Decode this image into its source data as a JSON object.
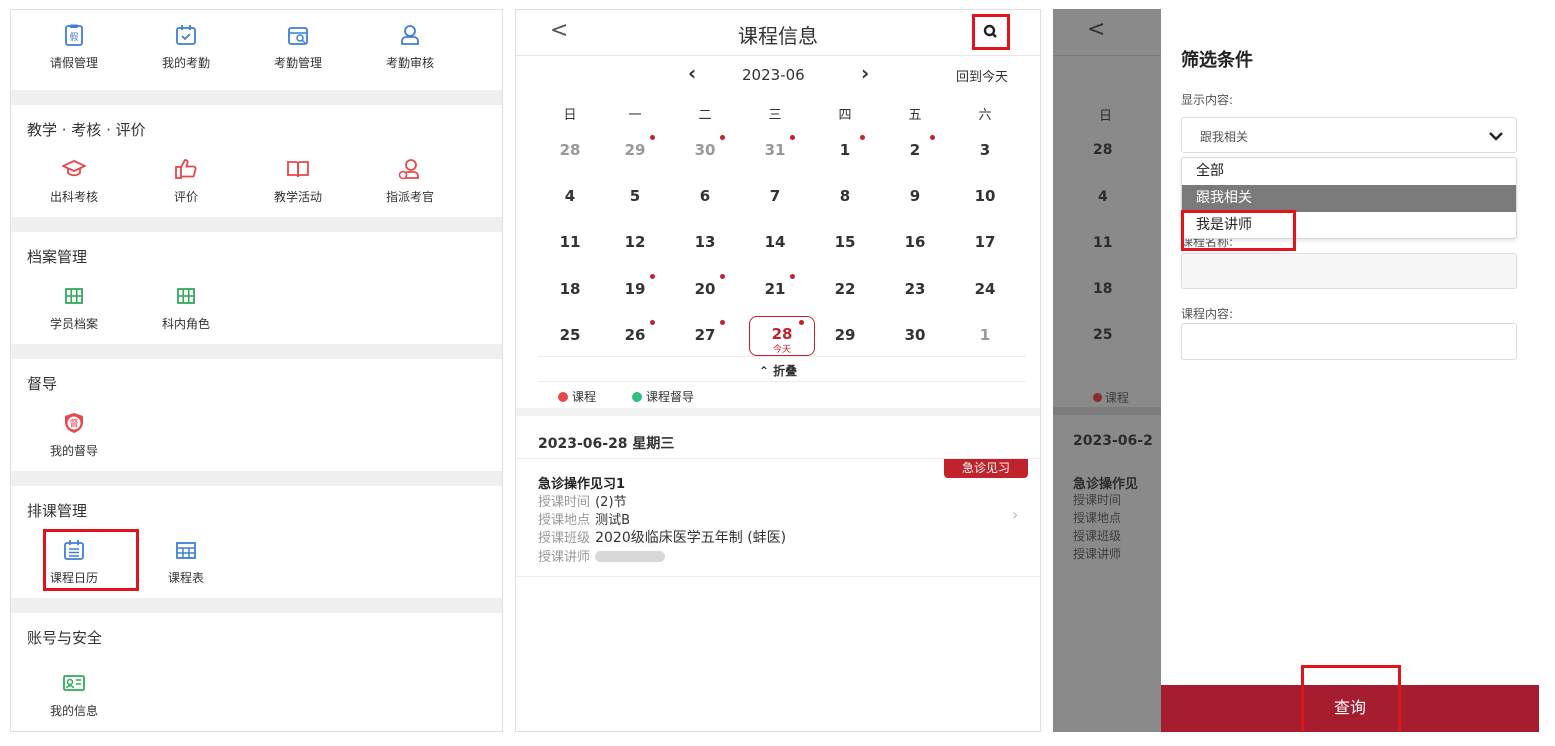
{
  "panel1": {
    "sections": [
      {
        "title": "",
        "items": [
          {
            "label": "请假管理",
            "icon": "leave-clipboard-icon"
          },
          {
            "label": "我的考勤",
            "icon": "calendar-check-icon"
          },
          {
            "label": "考勤管理",
            "icon": "calendar-search-icon"
          },
          {
            "label": "考勤审核",
            "icon": "user-review-icon"
          }
        ]
      },
      {
        "title": "教学 · 考核 · 评价",
        "items": [
          {
            "label": "出科考核",
            "icon": "graduation-cap-icon"
          },
          {
            "label": "评价",
            "icon": "thumbs-up-icon"
          },
          {
            "label": "教学活动",
            "icon": "open-book-icon"
          },
          {
            "label": "指派考官",
            "icon": "assign-user-icon"
          }
        ]
      },
      {
        "title": "档案管理",
        "items": [
          {
            "label": "学员档案",
            "icon": "grid-icon"
          },
          {
            "label": "科内角色",
            "icon": "grid-icon"
          }
        ]
      },
      {
        "title": "督导",
        "items": [
          {
            "label": "我的督导",
            "icon": "supervise-shield-icon",
            "glyph": "督"
          }
        ]
      },
      {
        "title": "排课管理",
        "items": [
          {
            "label": "课程日历",
            "icon": "course-calendar-icon"
          },
          {
            "label": "课程表",
            "icon": "timetable-icon"
          }
        ]
      },
      {
        "title": "账号与安全",
        "items": [
          {
            "label": "我的信息",
            "icon": "id-card-icon"
          }
        ]
      }
    ]
  },
  "panel2": {
    "back_icon": "<",
    "title": "课程信息",
    "search_icon": "search-icon",
    "month": {
      "prev": "‹",
      "label": "2023-06",
      "next": "›",
      "today_link": "回到今天"
    },
    "weekdays": [
      "日",
      "一",
      "二",
      "三",
      "四",
      "五",
      "六"
    ],
    "weeks": [
      [
        {
          "d": "28",
          "dim": true
        },
        {
          "d": "29",
          "dim": true,
          "dot": true
        },
        {
          "d": "30",
          "dim": true,
          "dot": true
        },
        {
          "d": "31",
          "dim": true,
          "dot": true
        },
        {
          "d": "1",
          "dot": true
        },
        {
          "d": "2",
          "dot": true
        },
        {
          "d": "3"
        }
      ],
      [
        {
          "d": "4"
        },
        {
          "d": "5"
        },
        {
          "d": "6"
        },
        {
          "d": "7"
        },
        {
          "d": "8"
        },
        {
          "d": "9"
        },
        {
          "d": "10"
        }
      ],
      [
        {
          "d": "11"
        },
        {
          "d": "12"
        },
        {
          "d": "13"
        },
        {
          "d": "14"
        },
        {
          "d": "15"
        },
        {
          "d": "16"
        },
        {
          "d": "17"
        }
      ],
      [
        {
          "d": "18"
        },
        {
          "d": "19",
          "dot": true
        },
        {
          "d": "20",
          "dot": true
        },
        {
          "d": "21",
          "dot": true
        },
        {
          "d": "22"
        },
        {
          "d": "23"
        },
        {
          "d": "24"
        }
      ],
      [
        {
          "d": "25"
        },
        {
          "d": "26",
          "dot": true
        },
        {
          "d": "27",
          "dot": true
        },
        {
          "d": "28",
          "today": true,
          "dot": true
        },
        {
          "d": "29"
        },
        {
          "d": "30"
        },
        {
          "d": "1",
          "dim": true
        }
      ]
    ],
    "today_sub": "今天",
    "collapse_label": "折叠",
    "legend": [
      {
        "label": "课程",
        "color": "#e8474b"
      },
      {
        "label": "课程督导",
        "color": "#2fc07c"
      }
    ],
    "date_header": "2023-06-28 星期三",
    "course": {
      "name": "急诊操作见习1",
      "tag": "急诊见习",
      "rows": [
        {
          "label": "授课时间",
          "value": "(2)节"
        },
        {
          "label": "授课地点",
          "value": "测试B"
        },
        {
          "label": "授课班级",
          "value": "2020级临床医学五年制 (蚌医)"
        },
        {
          "label": "授课讲师",
          "value": ""
        }
      ]
    }
  },
  "panel3": {
    "bg": {
      "back": "<",
      "weekday": "日",
      "days": [
        "28",
        "4",
        "11",
        "18",
        "25"
      ],
      "legend": "课程",
      "date": "2023-06-2",
      "course_name": "急诊操作见",
      "labels": [
        "授课时间",
        "授课地点",
        "授课班级",
        "授课讲师"
      ]
    },
    "title": "筛选条件",
    "display_label": "显示内容:",
    "display_value": "跟我相关",
    "dropdown_options": [
      "全部",
      "跟我相关",
      "我是讲师"
    ],
    "course_name_label": "课程名称:",
    "course_content_label": "课程内容:",
    "query_button": "查询"
  }
}
